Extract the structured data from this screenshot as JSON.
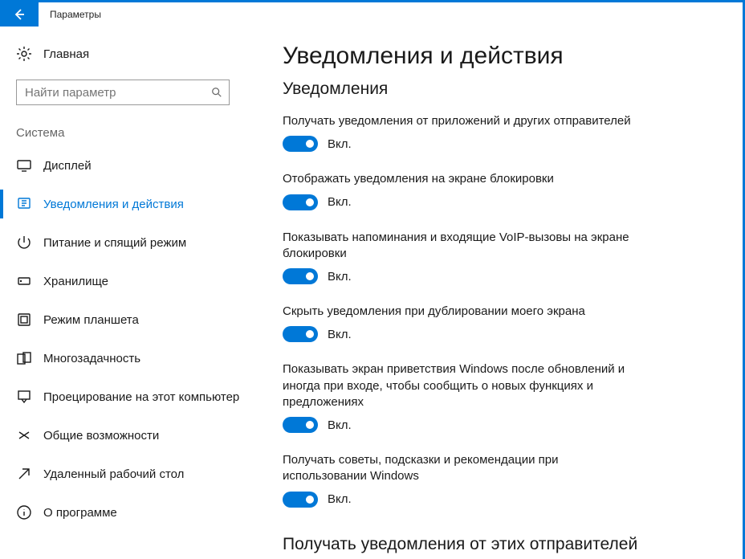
{
  "window": {
    "title": "Параметры"
  },
  "home": {
    "label": "Главная"
  },
  "search": {
    "placeholder": "Найти параметр"
  },
  "category": "Система",
  "nav": {
    "items": [
      {
        "label": "Дисплей"
      },
      {
        "label": "Уведомления и действия"
      },
      {
        "label": "Питание и спящий режим"
      },
      {
        "label": "Хранилище"
      },
      {
        "label": "Режим планшета"
      },
      {
        "label": "Многозадачность"
      },
      {
        "label": "Проецирование на этот компьютер"
      },
      {
        "label": "Общие возможности"
      },
      {
        "label": "Удаленный рабочий стол"
      },
      {
        "label": "О программе"
      }
    ]
  },
  "main": {
    "title": "Уведомления и действия",
    "section1": "Уведомления",
    "settings": [
      {
        "label": "Получать уведомления от приложений и других отправителей",
        "state": "Вкл."
      },
      {
        "label": "Отображать уведомления на экране блокировки",
        "state": "Вкл."
      },
      {
        "label": "Показывать напоминания и входящие VoIP-вызовы на экране блокировки",
        "state": "Вкл."
      },
      {
        "label": "Скрыть уведомления при дублировании моего экрана",
        "state": "Вкл."
      },
      {
        "label": "Показывать экран приветствия Windows после обновлений и иногда при входе, чтобы сообщить о новых функциях и предложениях",
        "state": "Вкл."
      },
      {
        "label": "Получать советы, подсказки и рекомендации при использовании Windows",
        "state": "Вкл."
      }
    ],
    "section2": "Получать уведомления от этих отправителей"
  }
}
